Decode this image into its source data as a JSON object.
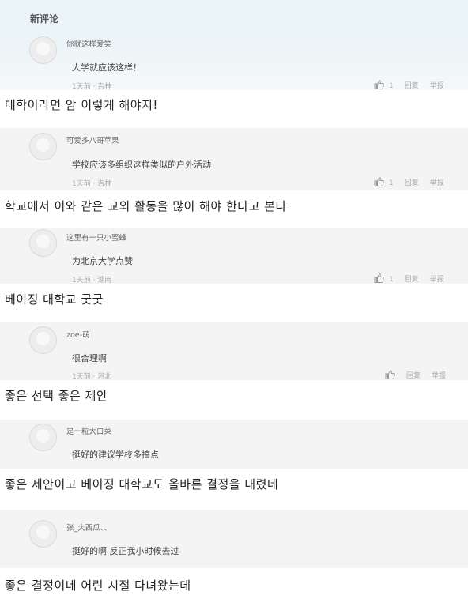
{
  "section_title": "新评论",
  "comments": [
    {
      "user": "你就这样爱笑",
      "text": "大学就应该这样！",
      "meta": "1天前 · 吉林",
      "likes": "1",
      "reply": "回复",
      "report": "举报",
      "translation": "대학이라면 암 이렇게 해야지!"
    },
    {
      "user": "可爱多八哥苹果",
      "text": "学校应该多组织这样类似的户外活动",
      "meta": "1天前 · 吉林",
      "likes": "1",
      "reply": "回复",
      "report": "举报",
      "translation": "학교에서 이와 같은 교외 활동을 많이 해야 한다고 본다"
    },
    {
      "user": "这里有一只小蜜蜂",
      "text": "为北京大学点赞",
      "meta": "1天前 · 湖南",
      "likes": "1",
      "reply": "回复",
      "report": "举报",
      "translation": "베이징 대학교 굿굿"
    },
    {
      "user": "zoe-萌",
      "text": "很合理啊",
      "meta": "1天前 · 河北",
      "likes": "",
      "reply": "回复",
      "report": "举报",
      "translation": "좋은 선택 좋은 제안"
    },
    {
      "user": "是一粒大白菜",
      "text": "挺好的建议学校多搞点",
      "meta": "",
      "likes": "",
      "reply": "",
      "report": "",
      "translation": "좋은 제안이고 베이징 대학교도 올바른 결정을 내렸네"
    },
    {
      "user": "张_大西瓜、、",
      "text": "挺好的啊 反正我小时候去过",
      "meta": "",
      "likes": "",
      "reply": "",
      "report": "",
      "translation": "좋은 결정이네 어린 시절 다녀왔는데"
    }
  ]
}
